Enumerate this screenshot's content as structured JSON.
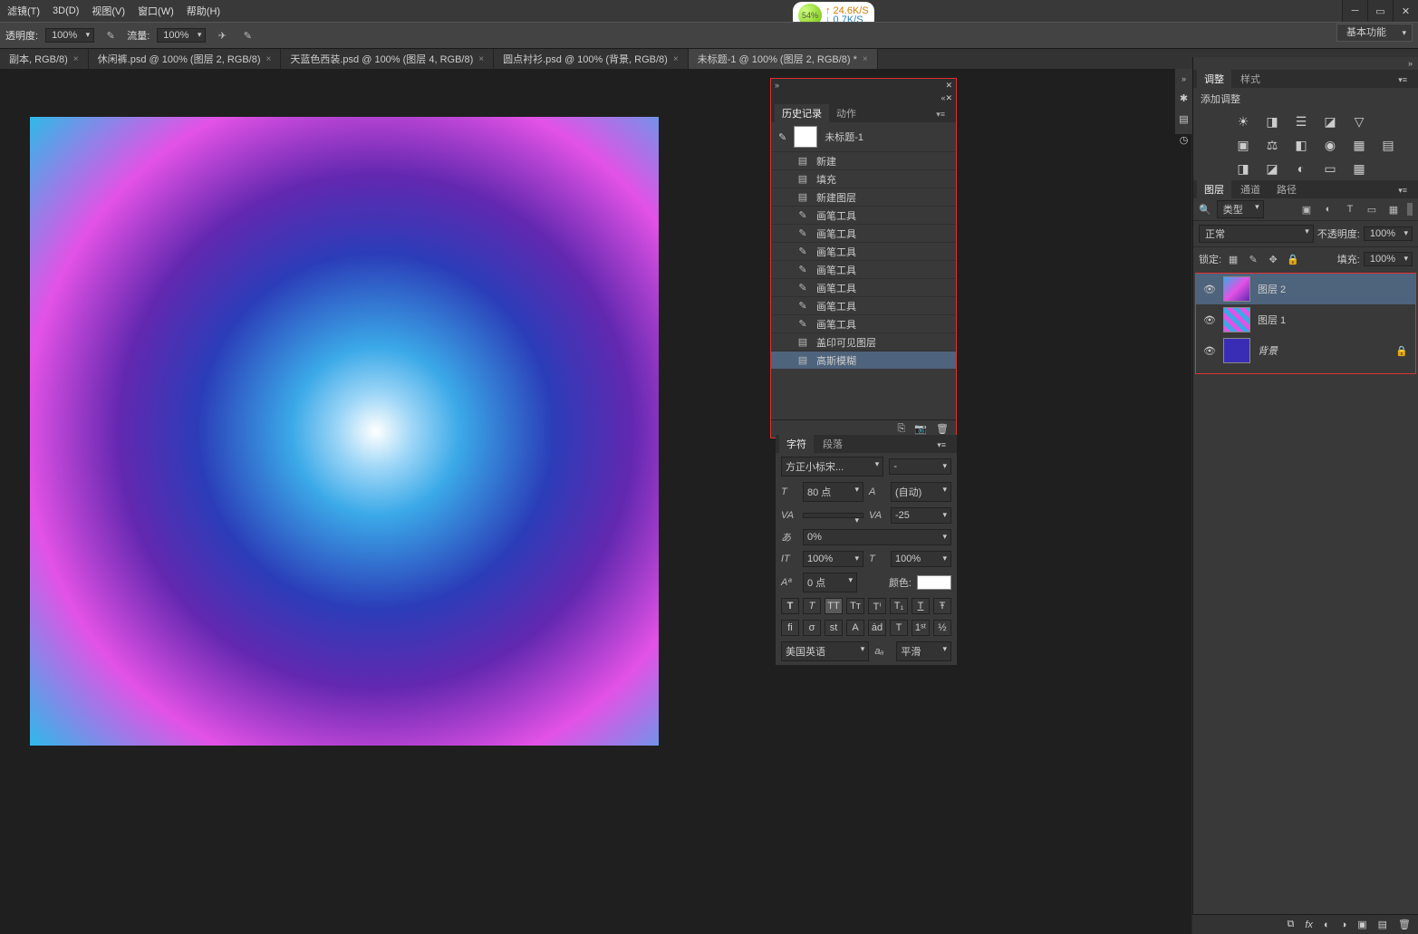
{
  "menu": {
    "filter": "滤镜(T)",
    "threed": "3D(D)",
    "view": "视图(V)",
    "window": "窗口(W)",
    "help": "帮助(H)"
  },
  "net": {
    "pct": "54%",
    "up": "↑ 24.6K/S",
    "down": "↓ 0.7K/S"
  },
  "options": {
    "opacity_label": "透明度:",
    "opacity_val": "100%",
    "flow_label": "流量:",
    "flow_val": "100%"
  },
  "workspace": {
    "label": "基本功能"
  },
  "tabs": [
    {
      "label": "副本, RGB/8)"
    },
    {
      "label": "休闲裤.psd @ 100% (图层 2, RGB/8)"
    },
    {
      "label": "天蓝色西装.psd @ 100% (图层 4, RGB/8)"
    },
    {
      "label": "圆点衬衫.psd @ 100% (背景, RGB/8)"
    },
    {
      "label": "未标题-1 @ 100% (图层 2, RGB/8) *"
    }
  ],
  "adjust": {
    "tab1": "调整",
    "tab2": "样式",
    "label": "添加调整"
  },
  "layers_panel": {
    "tab1": "图层",
    "tab2": "通道",
    "tab3": "路径",
    "kind_label": "类型",
    "mode": "正常",
    "opacity_label": "不透明度:",
    "opacity_val": "100%",
    "lock_label": "锁定:",
    "fill_label": "填充:",
    "fill_val": "100%"
  },
  "layers": [
    {
      "name": "图层 2",
      "selected": true,
      "locked": false
    },
    {
      "name": "图层 1",
      "selected": false,
      "locked": false
    },
    {
      "name": "背景",
      "selected": false,
      "locked": true
    }
  ],
  "history": {
    "tab1": "历史记录",
    "tab2": "动作",
    "doc": "未标题-1",
    "items": [
      {
        "icon": "▤",
        "label": "新建"
      },
      {
        "icon": "▤",
        "label": "填充"
      },
      {
        "icon": "▤",
        "label": "新建图层"
      },
      {
        "icon": "✎",
        "label": "画笔工具"
      },
      {
        "icon": "✎",
        "label": "画笔工具"
      },
      {
        "icon": "✎",
        "label": "画笔工具"
      },
      {
        "icon": "✎",
        "label": "画笔工具"
      },
      {
        "icon": "✎",
        "label": "画笔工具"
      },
      {
        "icon": "✎",
        "label": "画笔工具"
      },
      {
        "icon": "✎",
        "label": "画笔工具"
      },
      {
        "icon": "▤",
        "label": "盖印可见图层"
      },
      {
        "icon": "▤",
        "label": "高斯模糊",
        "selected": true
      }
    ]
  },
  "char": {
    "tab1": "字符",
    "tab2": "段落",
    "font": "方正小标宋...",
    "style": "-",
    "size_l": "T",
    "size": "80 点",
    "lead_l": "A",
    "lead": "(自动)",
    "va_l": "VA",
    "va": "",
    "av_l": "VA",
    "av": "-25",
    "scale_l": "あ",
    "scale": "0%",
    "vs_l": "IT",
    "vs": "100%",
    "hs_l": "T",
    "hs": "100%",
    "base_l": "Aª",
    "base": "0 点",
    "color_l": "颜色:",
    "lang": "美国英语",
    "aa_l": "aₐ",
    "aa": "平滑"
  }
}
